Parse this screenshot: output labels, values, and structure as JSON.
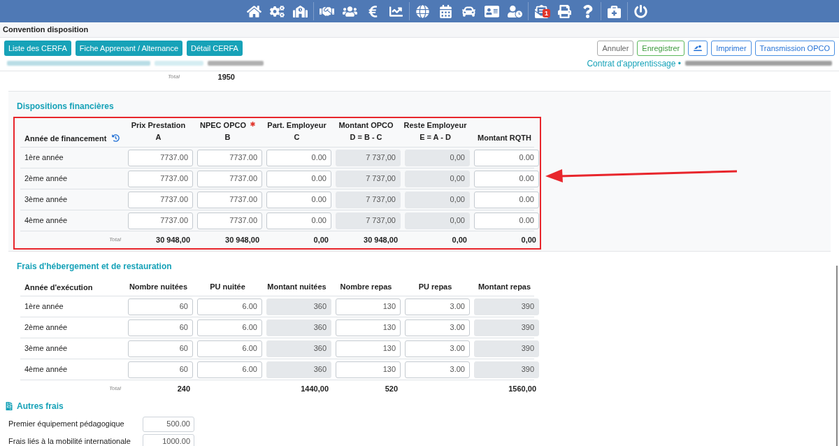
{
  "navbar": {
    "badge": "1"
  },
  "page_title": "Convention disposition",
  "left_buttons": [
    "Liste des CERFA",
    "Fiche Apprenant / Alternance",
    "Détail CERFA"
  ],
  "right_buttons": [
    {
      "kind": "cancel",
      "label": "Annuler"
    },
    {
      "kind": "save",
      "label": "Enregistrer"
    },
    {
      "kind": "icon"
    },
    {
      "kind": "primary",
      "label": "Imprimer"
    },
    {
      "kind": "primary",
      "label": "Transmission OPCO"
    }
  ],
  "contract_label": "Contrat d'apprentissage •",
  "previous_total": {
    "label": "Total",
    "value": "1950"
  },
  "financial": {
    "title": "Dispositions financières",
    "row_header": "Année de financement",
    "highlighted": true,
    "columns": [
      {
        "label": "Prix Prestation",
        "formula": "A",
        "required": false
      },
      {
        "label": "NPEC OPCO",
        "formula": "B",
        "required": true
      },
      {
        "label": "Part. Employeur",
        "formula": "C",
        "required": false
      },
      {
        "label": "Montant OPCO",
        "formula": "D = B - C",
        "required": false
      },
      {
        "label": "Reste Employeur",
        "formula": "E = A - D",
        "required": false
      },
      {
        "label": "Montant RQTH",
        "required": false
      }
    ],
    "rows": [
      {
        "label": "1ère année",
        "cells": [
          {
            "value": "7737.00",
            "readonly": false
          },
          {
            "value": "7737.00",
            "readonly": false
          },
          {
            "value": "0.00",
            "readonly": false
          },
          {
            "value": "7 737,00",
            "readonly": true
          },
          {
            "value": "0,00",
            "readonly": true
          },
          {
            "value": "0.00",
            "readonly": false
          }
        ]
      },
      {
        "label": "2ème année",
        "cells": [
          {
            "value": "7737.00",
            "readonly": false
          },
          {
            "value": "7737.00",
            "readonly": false
          },
          {
            "value": "0.00",
            "readonly": false
          },
          {
            "value": "7 737,00",
            "readonly": true
          },
          {
            "value": "0,00",
            "readonly": true
          },
          {
            "value": "0.00",
            "readonly": false
          }
        ]
      },
      {
        "label": "3ème année",
        "cells": [
          {
            "value": "7737.00",
            "readonly": false
          },
          {
            "value": "7737.00",
            "readonly": false
          },
          {
            "value": "0.00",
            "readonly": false
          },
          {
            "value": "7 737,00",
            "readonly": true
          },
          {
            "value": "0,00",
            "readonly": true
          },
          {
            "value": "0.00",
            "readonly": false
          }
        ]
      },
      {
        "label": "4ème année",
        "cells": [
          {
            "value": "7737.00",
            "readonly": false
          },
          {
            "value": "7737.00",
            "readonly": false
          },
          {
            "value": "0.00",
            "readonly": false
          },
          {
            "value": "7 737,00",
            "readonly": true
          },
          {
            "value": "0,00",
            "readonly": true
          },
          {
            "value": "0.00",
            "readonly": false
          }
        ]
      }
    ],
    "total": {
      "label": "Total",
      "values": {
        "column_1": "30 948,00",
        "column_2": "30 948,00",
        "column_3": "0,00",
        "column_4": "30 948,00",
        "column_5": "0,00",
        "column_6": "0,00"
      }
    }
  },
  "lodging": {
    "title": "Frais d'hébergement et de restauration",
    "row_header": "Année d'exécution",
    "highlighted": false,
    "columns": [
      {
        "label": "Nombre nuitées"
      },
      {
        "label": "PU nuitée"
      },
      {
        "label": "Montant nuitées"
      },
      {
        "label": "Nombre repas"
      },
      {
        "label": "PU repas"
      },
      {
        "label": "Montant repas"
      }
    ],
    "rows": [
      {
        "label": "1ère année",
        "cells": [
          {
            "value": "60",
            "readonly": false
          },
          {
            "value": "6.00",
            "readonly": false
          },
          {
            "value": "360",
            "readonly": true
          },
          {
            "value": "130",
            "readonly": false
          },
          {
            "value": "3.00",
            "readonly": false
          },
          {
            "value": "390",
            "readonly": true
          }
        ]
      },
      {
        "label": "2ème année",
        "cells": [
          {
            "value": "60",
            "readonly": false
          },
          {
            "value": "6.00",
            "readonly": false
          },
          {
            "value": "360",
            "readonly": true
          },
          {
            "value": "130",
            "readonly": false
          },
          {
            "value": "3.00",
            "readonly": false
          },
          {
            "value": "390",
            "readonly": true
          }
        ]
      },
      {
        "label": "3ème année",
        "cells": [
          {
            "value": "60",
            "readonly": false
          },
          {
            "value": "6.00",
            "readonly": false
          },
          {
            "value": "360",
            "readonly": true
          },
          {
            "value": "130",
            "readonly": false
          },
          {
            "value": "3.00",
            "readonly": false
          },
          {
            "value": "390",
            "readonly": true
          }
        ]
      },
      {
        "label": "4ème année",
        "cells": [
          {
            "value": "60",
            "readonly": false
          },
          {
            "value": "6.00",
            "readonly": false
          },
          {
            "value": "360",
            "readonly": true
          },
          {
            "value": "130",
            "readonly": false
          },
          {
            "value": "3.00",
            "readonly": false
          },
          {
            "value": "390",
            "readonly": true
          }
        ]
      }
    ],
    "total": {
      "label": "Total",
      "values": {
        "column_1": "240",
        "column_3": "1440,00",
        "column_4": "520",
        "column_6": "1560,00"
      }
    }
  },
  "other_fees": {
    "title": "Autres frais",
    "items": [
      {
        "label": "Premier équipement pédagogique",
        "value": "500.00"
      },
      {
        "label": "Frais liés à la mobilité internationale",
        "value": "1000.00"
      }
    ]
  }
}
